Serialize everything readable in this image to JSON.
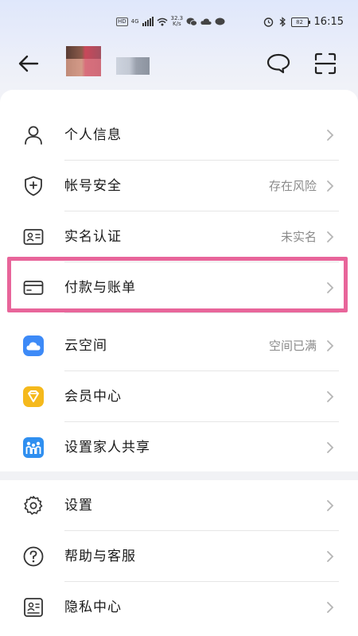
{
  "status_bar": {
    "hd": "HD",
    "network": "4G",
    "speed_value": "32.3",
    "speed_unit": "K/s",
    "battery": "82",
    "time": "16:15"
  },
  "menu_group1": [
    {
      "label": "个人信息",
      "value": "",
      "icon": "person-icon"
    },
    {
      "label": "帐号安全",
      "value": "存在风险",
      "icon": "shield-icon"
    },
    {
      "label": "实名认证",
      "value": "未实名",
      "icon": "id-card-icon"
    },
    {
      "label": "付款与账单",
      "value": "",
      "icon": "card-icon"
    },
    {
      "label": "云空间",
      "value": "空间已满",
      "icon": "cloud-icon"
    },
    {
      "label": "会员中心",
      "value": "",
      "icon": "vip-diamond-icon"
    },
    {
      "label": "设置家人共享",
      "value": "",
      "icon": "family-icon"
    }
  ],
  "menu_group2": [
    {
      "label": "设置",
      "value": "",
      "icon": "gear-icon"
    },
    {
      "label": "帮助与客服",
      "value": "",
      "icon": "help-icon"
    },
    {
      "label": "隐私中心",
      "value": "",
      "icon": "privacy-icon"
    }
  ],
  "colors": {
    "highlight": "#e8659a",
    "cloud_blue": "#3d8af7",
    "vip_gold": "#f5b91c",
    "family_blue": "#2f8ff0"
  }
}
